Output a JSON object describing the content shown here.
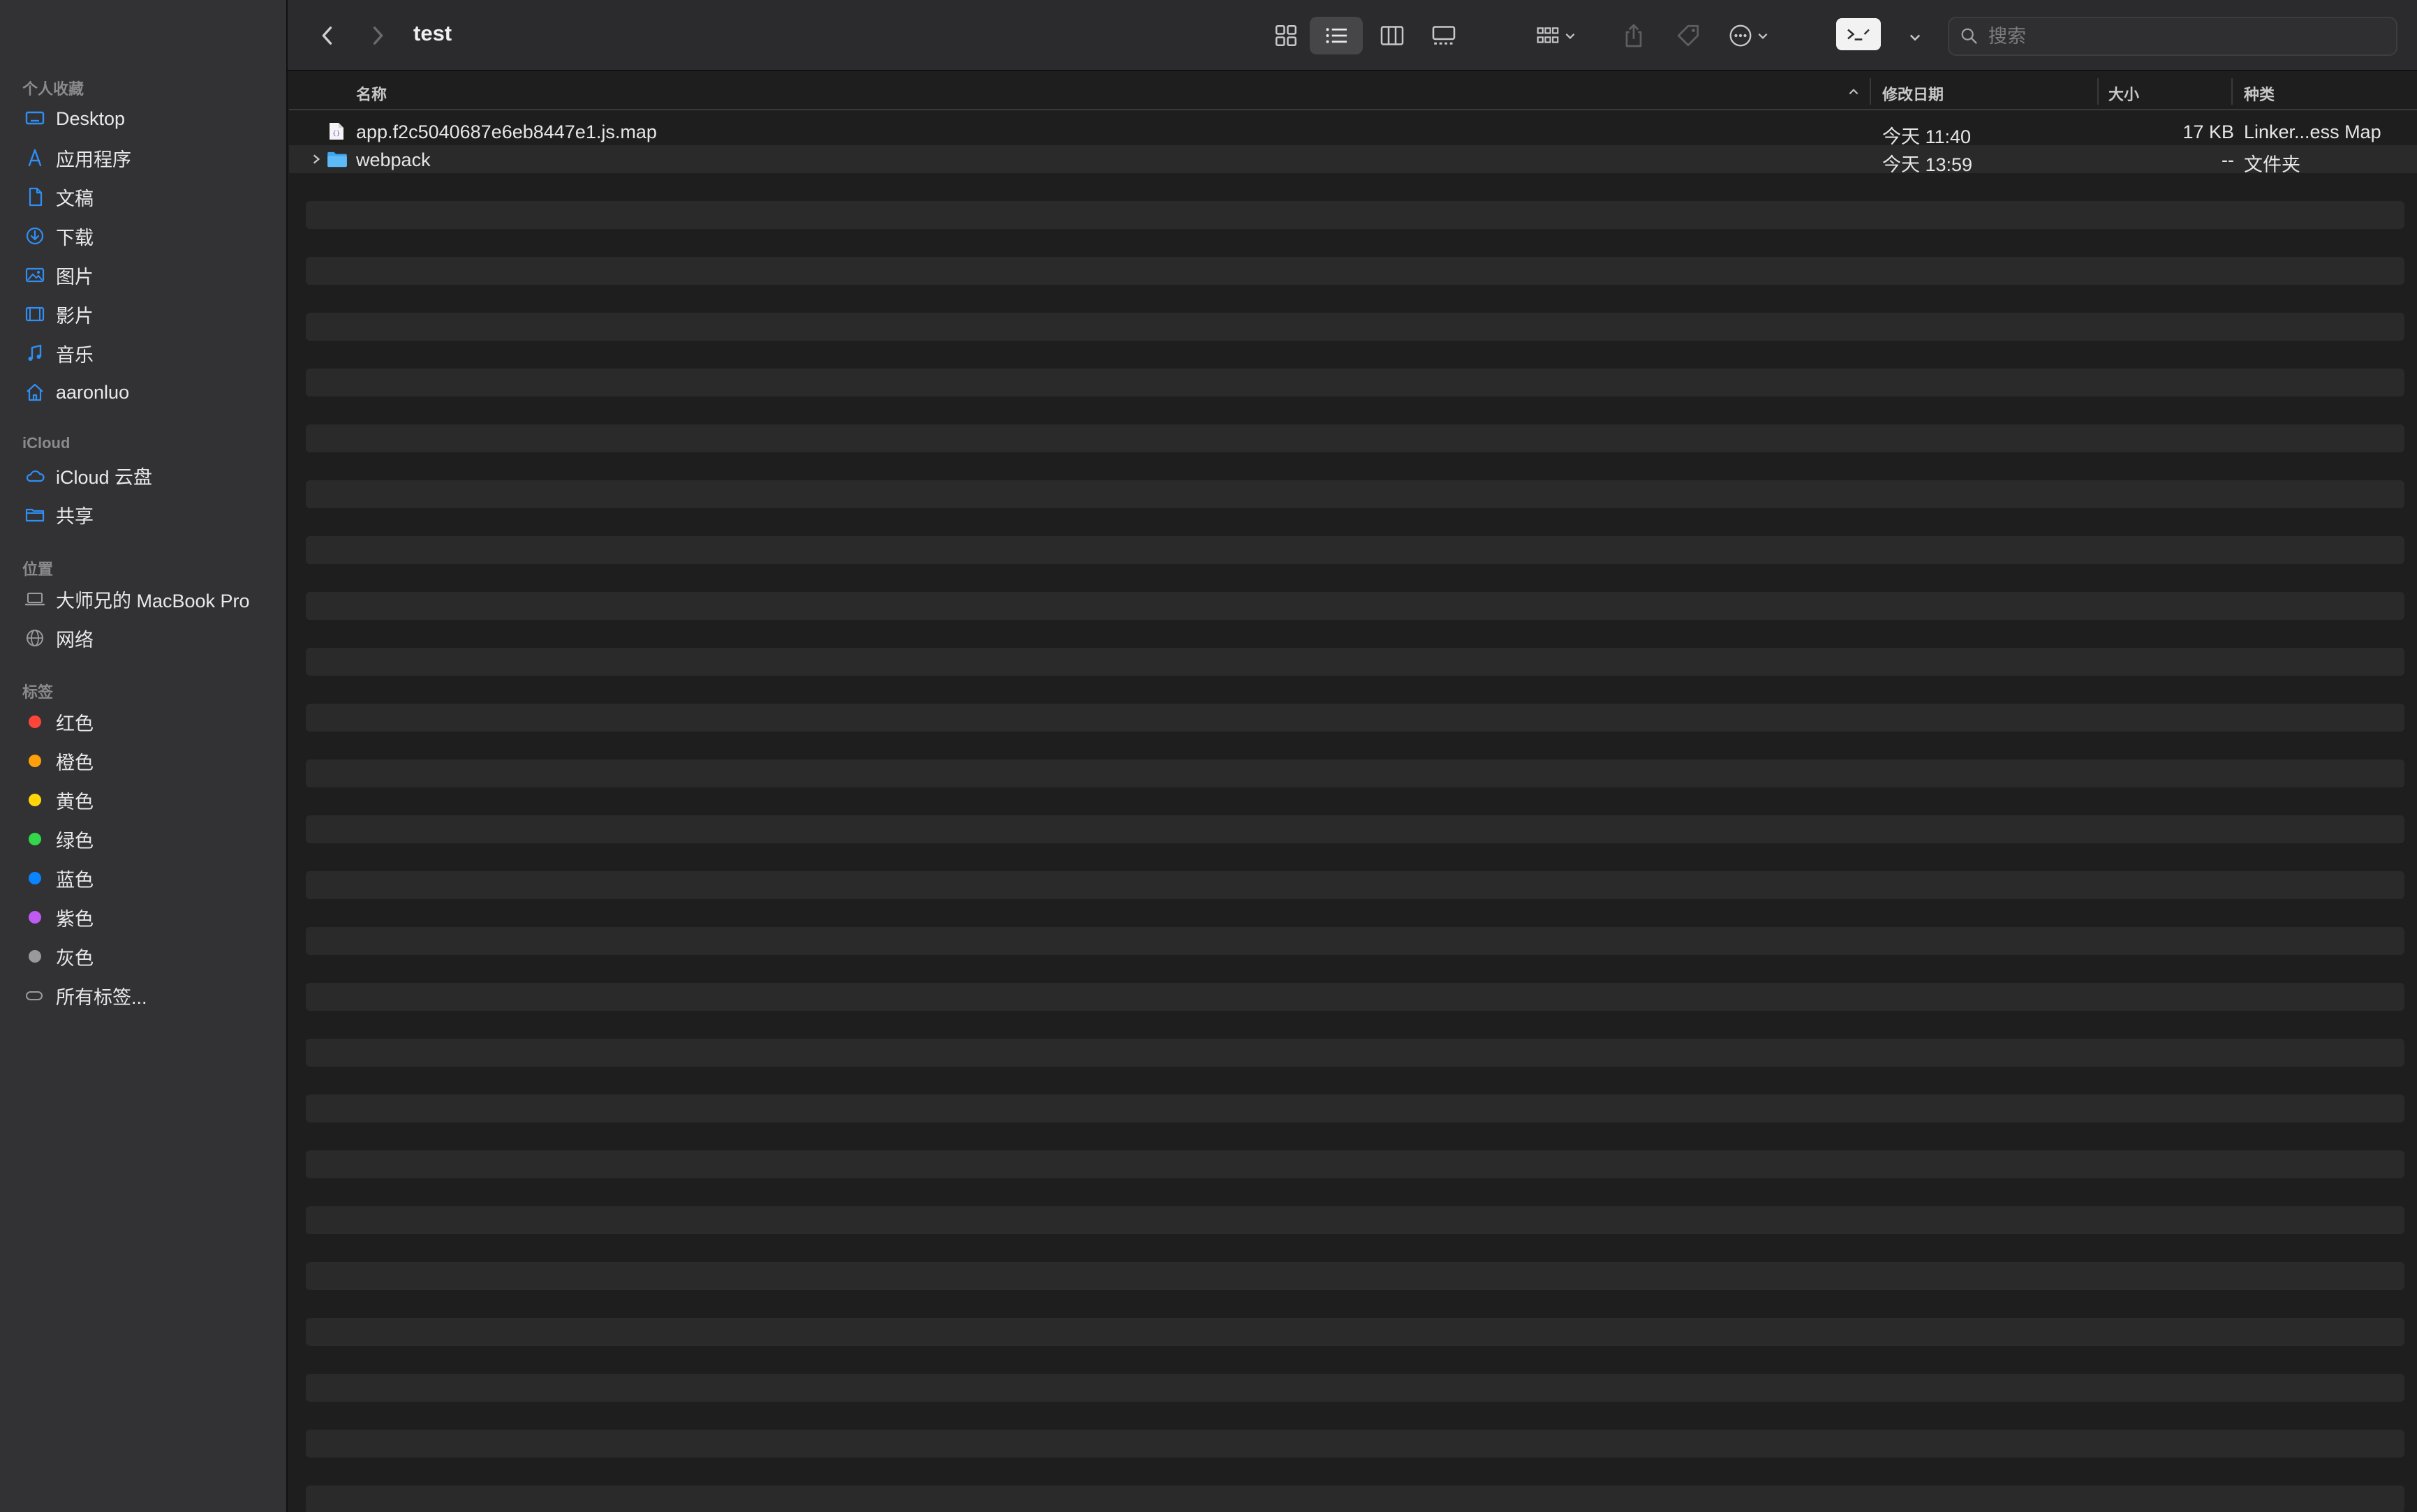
{
  "window": {
    "title": "test"
  },
  "toolbar": {
    "search_placeholder": "搜索",
    "view_icons": [
      "grid-view-icon",
      "list-view-icon",
      "column-view-icon",
      "gallery-view-icon"
    ],
    "active_view": "list"
  },
  "sidebar": {
    "favorites_title": "个人收藏",
    "favorites": [
      {
        "label": "Desktop",
        "icon": "desktop-icon"
      },
      {
        "label": "应用程序",
        "icon": "applications-icon"
      },
      {
        "label": "文稿",
        "icon": "documents-icon"
      },
      {
        "label": "下载",
        "icon": "downloads-icon"
      },
      {
        "label": "图片",
        "icon": "pictures-icon"
      },
      {
        "label": "影片",
        "icon": "movies-icon"
      },
      {
        "label": "音乐",
        "icon": "music-icon"
      },
      {
        "label": "aaronluo",
        "icon": "home-icon"
      }
    ],
    "icloud_title": "iCloud",
    "icloud": [
      {
        "label": "iCloud 云盘",
        "icon": "icloud-icon"
      },
      {
        "label": "共享",
        "icon": "shared-folder-icon"
      }
    ],
    "locations_title": "位置",
    "locations": [
      {
        "label": "大师兄的 MacBook Pro",
        "icon": "laptop-icon"
      },
      {
        "label": "网络",
        "icon": "network-icon"
      }
    ],
    "tags_title": "标签",
    "tags": [
      {
        "label": "红色",
        "color": "#ff453a"
      },
      {
        "label": "橙色",
        "color": "#ff9f0a"
      },
      {
        "label": "黄色",
        "color": "#ffd60a"
      },
      {
        "label": "绿色",
        "color": "#32d74b"
      },
      {
        "label": "蓝色",
        "color": "#0a84ff"
      },
      {
        "label": "紫色",
        "color": "#bf5af2"
      },
      {
        "label": "灰色",
        "color": "#98989d"
      }
    ],
    "all_tags_label": "所有标签..."
  },
  "list": {
    "columns": {
      "name": "名称",
      "modified": "修改日期",
      "size": "大小",
      "kind": "种类"
    },
    "files": [
      {
        "name": "app.f2c5040687e6eb8447e1.js.map",
        "modified": "今天 11:40",
        "size": "17 KB",
        "kind": "Linker...ess Map",
        "icon": "map-file-icon",
        "folder": false
      },
      {
        "name": "webpack",
        "modified": "今天 13:59",
        "size": "--",
        "kind": "文件夹",
        "icon": "folder-icon",
        "folder": true
      }
    ]
  },
  "colors": {
    "accent": "#0a84ff",
    "sidebar_icon": "#2f8ff5"
  }
}
